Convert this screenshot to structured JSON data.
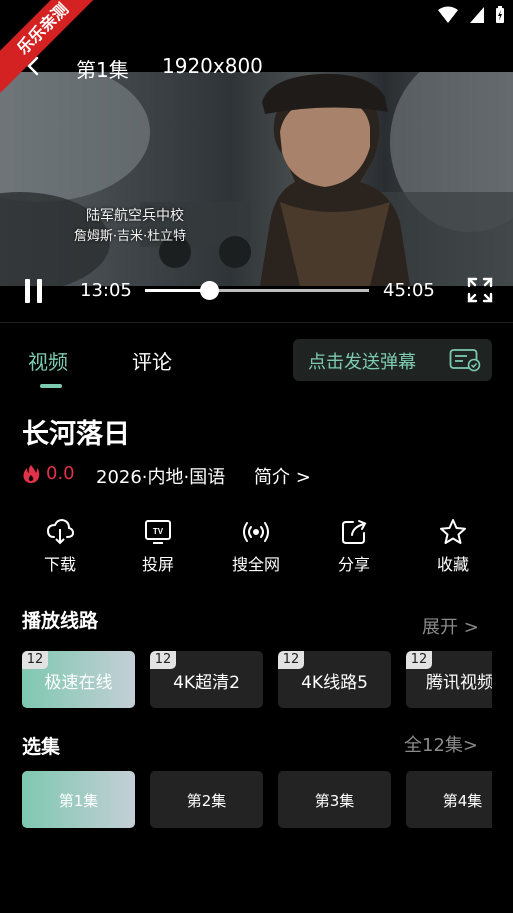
{
  "ribbon": {
    "text": "乐乐亲测"
  },
  "top_bar": {
    "episode": "第1集",
    "resolution": "1920x800"
  },
  "video": {
    "subtitle_line1": "陆军航空兵中校",
    "subtitle_line2": "詹姆斯·吉米·杜立特"
  },
  "player": {
    "current_time": "13:05",
    "duration": "45:05",
    "progress": 0.29
  },
  "tabs": [
    {
      "label": "视频",
      "active": true
    },
    {
      "label": "评论",
      "active": false
    }
  ],
  "danmaku": {
    "label": "点击发送弹幕"
  },
  "show": {
    "title": "长河落日",
    "rating": "0.0",
    "meta": "2026·内地·国语",
    "intro": "简介 >"
  },
  "actions": [
    {
      "label": "下载",
      "icon": "download-icon"
    },
    {
      "label": "投屏",
      "icon": "tv-cast-icon"
    },
    {
      "label": "搜全网",
      "icon": "broadcast-icon"
    },
    {
      "label": "分享",
      "icon": "share-icon"
    },
    {
      "label": "收藏",
      "icon": "star-icon"
    }
  ],
  "lines": {
    "title": "播放线路",
    "more": "展开 >",
    "items": [
      {
        "label": "极速在线",
        "badge": "12",
        "active": true
      },
      {
        "label": "4K超清2",
        "badge": "12",
        "active": false
      },
      {
        "label": "4K线路5",
        "badge": "12",
        "active": false
      },
      {
        "label": "腾讯视频",
        "badge": "12",
        "active": false
      }
    ]
  },
  "episodes": {
    "title": "选集",
    "more": "全12集>",
    "items": [
      {
        "label": "第1集",
        "active": true
      },
      {
        "label": "第2集",
        "active": false
      },
      {
        "label": "第3集",
        "active": false
      },
      {
        "label": "第4集",
        "active": false
      }
    ]
  },
  "colors": {
    "accent": "#7ccbb1",
    "rating": "#e0334a",
    "ribbon": "#d42121"
  }
}
